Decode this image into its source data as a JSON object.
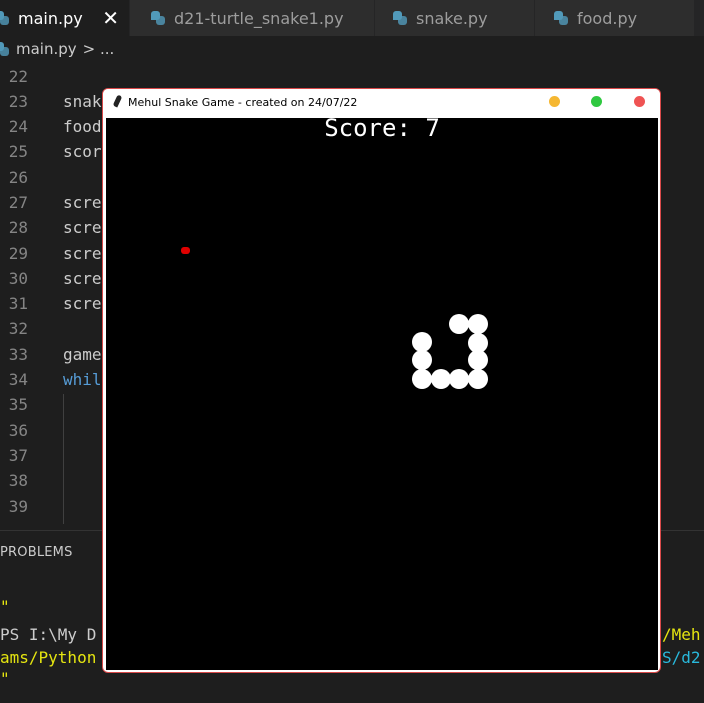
{
  "tabs": [
    {
      "label": "main.py",
      "active": true
    },
    {
      "label": "d21-turtle_snake1.py",
      "active": false
    },
    {
      "label": "snake.py",
      "active": false
    },
    {
      "label": "food.py",
      "active": false
    }
  ],
  "tab_close": "✕",
  "breadcrumb": {
    "file": "main.py",
    "more": "> ..."
  },
  "editor": {
    "lines": [
      {
        "num": "22",
        "code": ""
      },
      {
        "num": "23",
        "code": "snak"
      },
      {
        "num": "24",
        "code": "food"
      },
      {
        "num": "25",
        "code": "scor"
      },
      {
        "num": "26",
        "code": ""
      },
      {
        "num": "27",
        "code": "scre"
      },
      {
        "num": "28",
        "code": "scre"
      },
      {
        "num": "29",
        "code": "scre"
      },
      {
        "num": "30",
        "code": "scre"
      },
      {
        "num": "31",
        "code": "scre"
      },
      {
        "num": "32",
        "code": ""
      },
      {
        "num": "33",
        "code": "game"
      },
      {
        "num": "34",
        "code": "whil"
      },
      {
        "num": "35",
        "code": ""
      },
      {
        "num": "36",
        "code": ""
      },
      {
        "num": "37",
        "code": ""
      },
      {
        "num": "38",
        "code": ""
      },
      {
        "num": "39",
        "code": ""
      }
    ]
  },
  "panel": {
    "title": "PROBLEMS",
    "terminal": {
      "quote1": "\"",
      "prompt_left": "PS I:\\My D",
      "prompt_right": "/Meh",
      "path_left": "ams/Python",
      "path_right": "S/d2",
      "quote2": "\""
    }
  },
  "game_window": {
    "title": "Mehul Snake Game - created on 24/07/22",
    "score_text": "Score: 7",
    "colors": {
      "background": "#000000",
      "snake": "#ffffff",
      "food": "#e00000",
      "minimize": "#f5b731",
      "maximize": "#2fc840",
      "close": "#ef5353"
    }
  }
}
